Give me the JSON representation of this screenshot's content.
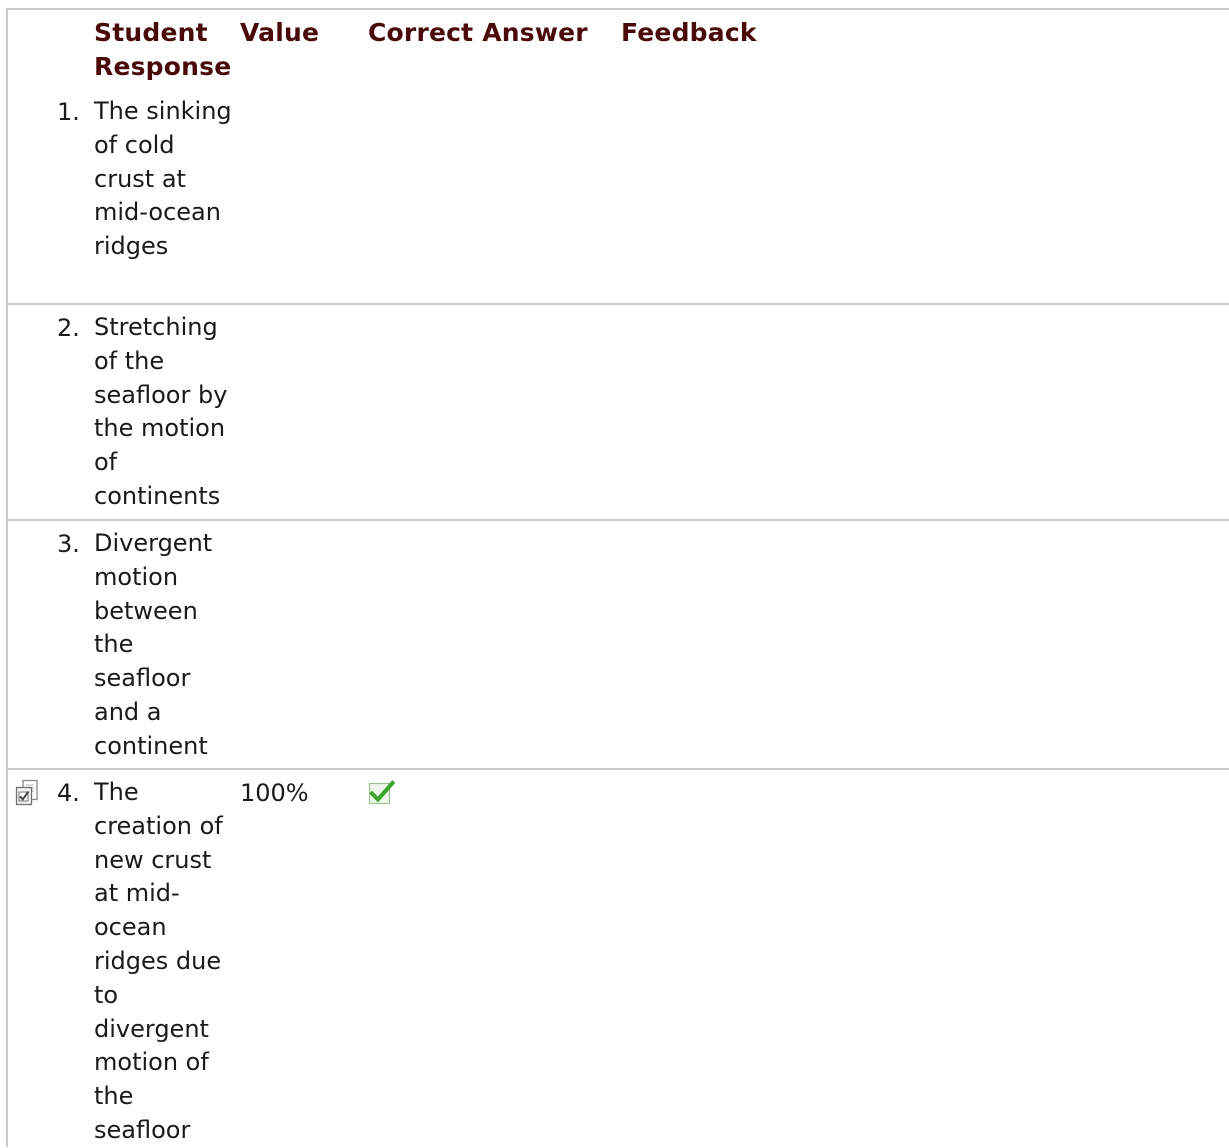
{
  "table": {
    "headers": {
      "student_response": "Student Response",
      "value": "Value",
      "correct_answer": "Correct Answer",
      "feedback": "Feedback"
    },
    "rows": [
      {
        "number": "1.",
        "response": "The sinking of cold crust at mid-ocean ridges",
        "value": "",
        "correct": false,
        "selected": false
      },
      {
        "number": "2.",
        "response": "Stretching of the seafloor by the motion of continents",
        "value": "",
        "correct": false,
        "selected": false
      },
      {
        "number": "3.",
        "response": "Divergent motion between the seafloor and a continent",
        "value": "",
        "correct": false,
        "selected": false
      },
      {
        "number": "4.",
        "response": "The creation of new crust at mid-ocean ridges due to divergent motion of the seafloor",
        "value": "100%",
        "correct": true,
        "selected": true
      }
    ]
  },
  "icons": {
    "selected_response": "document-check-icon",
    "correct_answer": "green-checkmark-icon"
  },
  "colors": {
    "header_text": "#4a0a0a",
    "body_text": "#1a1a1a",
    "border": "#c9c9c9",
    "check_green": "#3aa52a"
  }
}
